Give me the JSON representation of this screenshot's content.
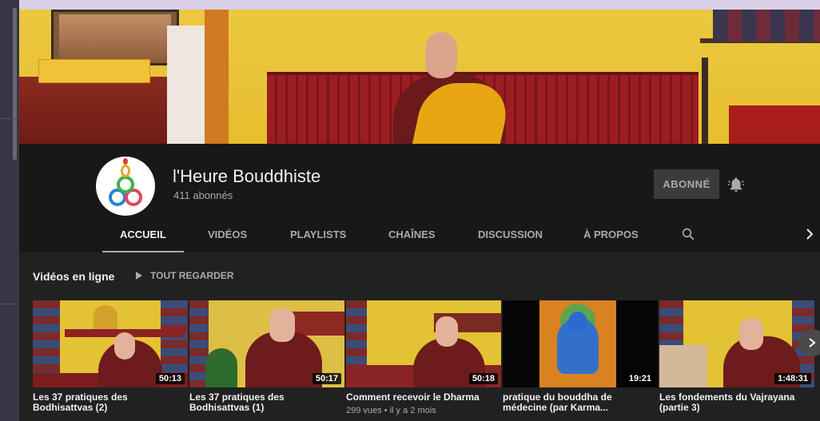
{
  "channel": {
    "name": "l'Heure Bouddhiste",
    "subscribers": "411 abonnés",
    "subscribe_button": "ABONNÉ"
  },
  "tabs": [
    {
      "label": "ACCUEIL",
      "active": true
    },
    {
      "label": "VIDÉOS"
    },
    {
      "label": "PLAYLISTS"
    },
    {
      "label": "CHAÎNES"
    },
    {
      "label": "DISCUSSION"
    },
    {
      "label": "À PROPOS"
    }
  ],
  "section": {
    "title": "Vidéos en ligne",
    "play_all": "TOUT REGARDER"
  },
  "videos": [
    {
      "title": "Les 37 pratiques des Bodhisattvas (2)",
      "duration": "50:13",
      "meta": ""
    },
    {
      "title": "Les 37 pratiques des Bodhisattvas (1)",
      "duration": "50:17",
      "meta": ""
    },
    {
      "title": "Comment recevoir le Dharma",
      "duration": "50:18",
      "meta": "299 vues • il y a 2 mois"
    },
    {
      "title": "pratique du bouddha de médecine (par Karma...",
      "duration": "19:21",
      "meta": ""
    },
    {
      "title": "Les fondements du Vajrayana (partie 3)",
      "duration": "1:48:31",
      "meta": ""
    }
  ],
  "icons": {
    "bell": "bell-icon",
    "search": "search-icon",
    "next": "chevron-right-icon",
    "play": "play-icon"
  },
  "colors": {
    "background": "#212121",
    "header": "#181818",
    "text": "#f1f1f1",
    "muted": "#aaaaaa"
  }
}
